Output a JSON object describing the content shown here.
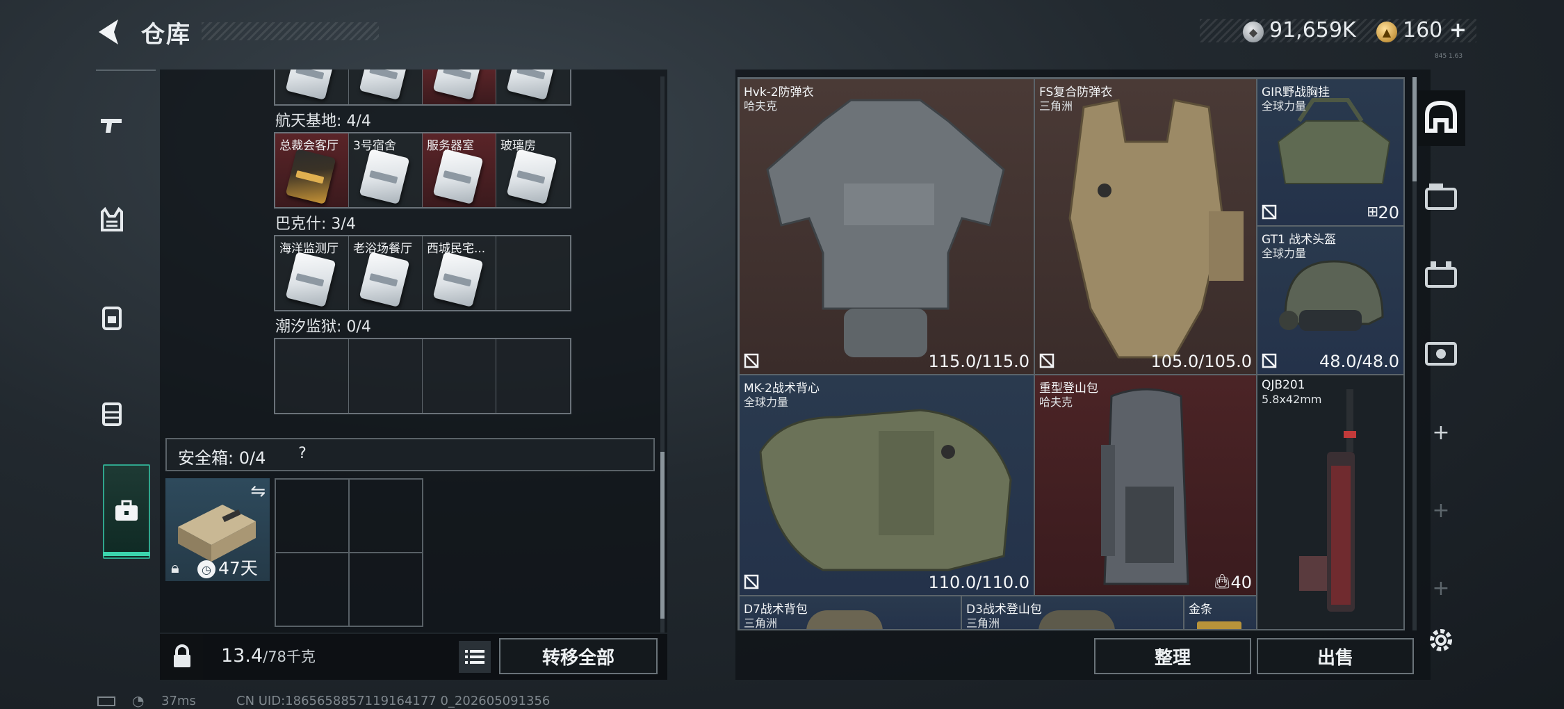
{
  "header": {
    "title": "仓库",
    "currency1": "91,659K",
    "currency2": "160",
    "currency2_add": "+",
    "version": "845 1.63"
  },
  "left_nav": [
    "pistol-icon",
    "vest-icon",
    "backpack-icon",
    "rig-icon",
    "safe-box-icon"
  ],
  "storage": {
    "sections": [
      {
        "label": "航天基地: 4/4",
        "slots": [
          {
            "name": "总裁会客厅",
            "card": "gold",
            "bg": "red"
          },
          {
            "name": "3号宿舍",
            "card": "white",
            "bg": "dark"
          },
          {
            "name": "服务器室",
            "card": "white",
            "bg": "red"
          },
          {
            "name": "玻璃房",
            "card": "white",
            "bg": "dark"
          }
        ]
      },
      {
        "label": "巴克什: 3/4",
        "slots": [
          {
            "name": "海洋监测厅",
            "card": "white",
            "bg": "dark"
          },
          {
            "name": "老浴场餐厅",
            "card": "white",
            "bg": "dark"
          },
          {
            "name": "西城民宅...",
            "card": "white",
            "bg": "dark"
          },
          {
            "name": "",
            "card": "",
            "bg": "dark"
          }
        ]
      },
      {
        "label": "潮汐监狱: 0/4",
        "slots": [
          {
            "name": "",
            "card": "",
            "bg": "dark"
          },
          {
            "name": "",
            "card": "",
            "bg": "dark"
          },
          {
            "name": "",
            "card": "",
            "bg": "dark"
          },
          {
            "name": "",
            "card": "",
            "bg": "dark"
          }
        ]
      }
    ],
    "safe_label": "安全箱: 0/4",
    "safe_help": "?",
    "safe_item_time": "47天",
    "weight_value": "13.4",
    "weight_unit": "/78千克",
    "transfer_label": "转移全部"
  },
  "inventory": {
    "items": [
      {
        "name": "Hvk-2防弹衣",
        "sub": "哈夫克",
        "value": "115.0/115.0"
      },
      {
        "name": "FS复合防弹衣",
        "sub": "三角洲",
        "value": "105.0/105.0"
      },
      {
        "name": "GIR野战胸挂",
        "sub": "全球力量",
        "value": "20"
      },
      {
        "name": "GT1 战术头盔",
        "sub": "全球力量",
        "value": "48.0/48.0"
      },
      {
        "name": "MK-2战术背心",
        "sub": "全球力量",
        "value": "110.0/110.0"
      },
      {
        "name": "重型登山包",
        "sub": "哈夫克",
        "value": "40"
      },
      {
        "name": "QJB201",
        "sub": "5.8x42mm",
        "value": ""
      },
      {
        "name": "D7战术背包",
        "sub": "三角洲",
        "value": ""
      },
      {
        "name": "D3战术登山包",
        "sub": "三角洲",
        "value": ""
      },
      {
        "name": "金条",
        "sub": "",
        "value": ""
      }
    ],
    "sort_label": "整理",
    "sell_label": "出售"
  },
  "right_nav": [
    "helmet-slot-icon",
    "armor-slot-icon",
    "rig-slot-icon",
    "bag-slot-icon",
    "plus",
    "plus",
    "plus"
  ],
  "status": {
    "ping": "37ms",
    "uid": "CN UID:1865658857119164177 0_202605091356"
  },
  "colors": {
    "accent": "#3bd4ad",
    "cell_brown": "#4a3a36",
    "cell_blue": "#2a3a4e",
    "cell_red": "#4b2426"
  }
}
